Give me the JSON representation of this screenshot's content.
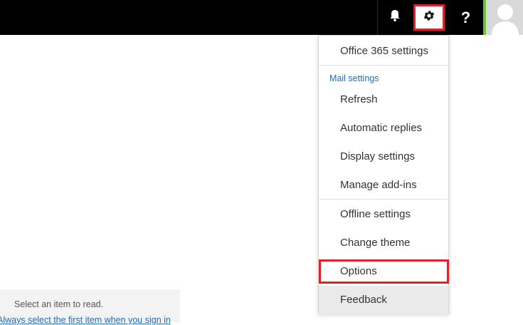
{
  "topbar": {
    "help_label": "?"
  },
  "settings_menu": {
    "items_top": [
      "Office 365 settings"
    ],
    "section_title": "Mail settings",
    "mail_items": [
      "Refresh",
      "Automatic replies",
      "Display settings",
      "Manage add-ins"
    ],
    "other_items": [
      "Offline settings",
      "Change theme",
      "Options",
      "Feedback"
    ]
  },
  "reading_pane": {
    "prompt": "Select an item to read.",
    "link": "Always select the first item when you sign in"
  },
  "colors": {
    "highlight": "#e0202a",
    "accent": "#1f6bbf",
    "presence": "#6cbf3f"
  }
}
